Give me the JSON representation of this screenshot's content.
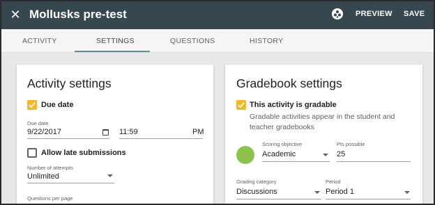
{
  "header": {
    "title": "Mollusks pre-test",
    "close_icon": "close-icon",
    "avatar_icon": "avatar-icon",
    "preview_label": "PREVIEW",
    "save_label": "SAVE"
  },
  "tabs": [
    {
      "label": "ACTIVITY",
      "active": false
    },
    {
      "label": "SETTINGS",
      "active": true
    },
    {
      "label": "QUESTIONS",
      "active": false
    },
    {
      "label": "HISTORY",
      "active": false
    }
  ],
  "activity_settings": {
    "title": "Activity settings",
    "due_date": {
      "label": "Due date",
      "checked": true
    },
    "due_date_field": {
      "label": "Due date",
      "date": "9/22/2017",
      "time": "11:59",
      "ampm": "PM"
    },
    "allow_late": {
      "label": "Allow late submissions",
      "checked": false
    },
    "attempts": {
      "label": "Number of attempts",
      "value": "Unlimited"
    },
    "questions_per_page": {
      "label": "Questions per page"
    }
  },
  "gradebook_settings": {
    "title": "Gradebook settings",
    "gradable": {
      "label": "This activity is gradable",
      "checked": true
    },
    "helper": "Gradable activities appear in the student and teacher gradebooks",
    "scoring_objective": {
      "label": "Scoring objective",
      "value": "Academic",
      "color": "#8bc34a"
    },
    "pts_possible": {
      "label": "Pts possible",
      "value": "25"
    },
    "grading_category": {
      "label": "Grading category",
      "value": "Discussions"
    },
    "period": {
      "label": "Period",
      "value": "Period 1"
    }
  },
  "colors": {
    "topbar": "#37474f",
    "accent_checkbox": "#f9b821",
    "tab_indicator": "#5f8e9a"
  }
}
